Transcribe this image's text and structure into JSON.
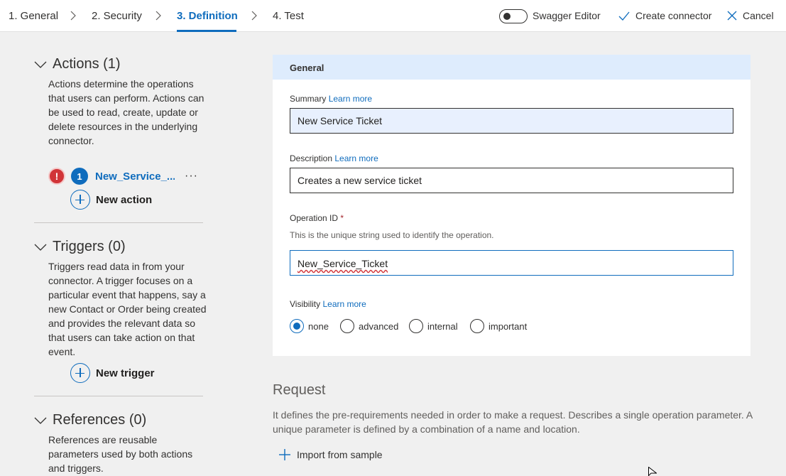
{
  "wizard": {
    "steps": [
      {
        "label": "1. General"
      },
      {
        "label": "2. Security"
      },
      {
        "label": "3. Definition"
      },
      {
        "label": "4. Test"
      }
    ],
    "active_step": 2,
    "swagger_toggle_label": "Swagger Editor",
    "swagger_toggle_on": false,
    "create_connector_label": "Create connector",
    "cancel_label": "Cancel"
  },
  "sidebar": {
    "actions": {
      "title": "Actions (1)",
      "description": "Actions determine the operations that users can perform. Actions can be used to read, create, update or delete resources in the underlying connector.",
      "items": [
        {
          "index": "1",
          "name": "New_Service_...",
          "error_icon": "!",
          "more": "···"
        }
      ],
      "add_label": "New action"
    },
    "triggers": {
      "title": "Triggers (0)",
      "description": "Triggers read data in from your connector. A trigger focuses on a particular event that happens, say a new Contact or Order being created and provides the relevant data so that users can take action on that event.",
      "add_label": "New trigger"
    },
    "references": {
      "title": "References (0)",
      "description": "References are reusable parameters used by both actions and triggers."
    }
  },
  "general": {
    "header": "General",
    "summary": {
      "label": "Summary",
      "learn_more": "Learn more",
      "value": "New Service Ticket"
    },
    "description": {
      "label": "Description",
      "learn_more": "Learn more",
      "value": "Creates a new service ticket"
    },
    "operation_id": {
      "label": "Operation ID",
      "required_mark": "*",
      "hint": "This is the unique string used to identify the operation.",
      "value": "New_Service_Ticket"
    },
    "visibility": {
      "label": "Visibility",
      "learn_more": "Learn more",
      "options": [
        "none",
        "advanced",
        "internal",
        "important"
      ],
      "selected": "none"
    }
  },
  "request": {
    "title": "Request",
    "description": "It defines the pre-requirements needed in order to make a request. Describes a single operation parameter. A unique parameter is defined by a combination of a name and location.",
    "import_label": "Import from sample"
  },
  "colors": {
    "accent": "#0f6cbd",
    "error": "#d13438",
    "card_header": "#deecfd"
  }
}
